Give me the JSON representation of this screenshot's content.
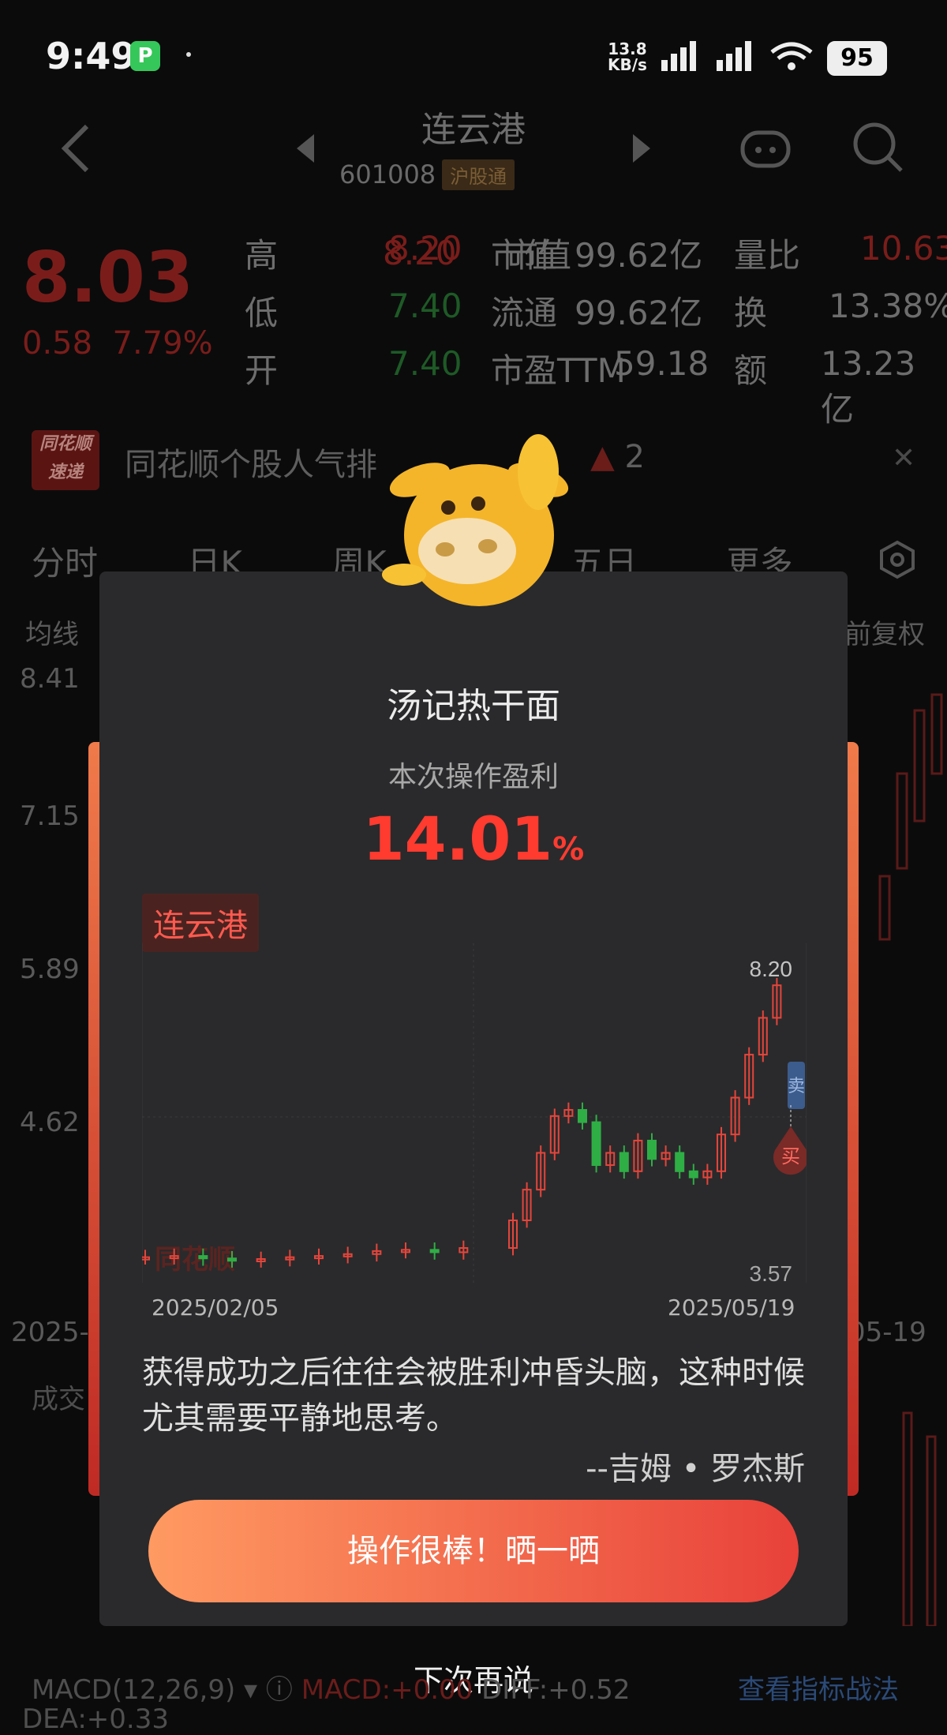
{
  "status_bar": {
    "time": "9:49",
    "app_icon": "P",
    "net_speed_value": "13.8",
    "net_speed_unit": "KB/s",
    "battery": "95"
  },
  "header": {
    "name": "连云港",
    "code": "601008",
    "tag": "沪股通"
  },
  "quote": {
    "price": "8.03",
    "change": "0.58",
    "change_pct": "7.79%",
    "rows": [
      {
        "k1": "高",
        "v1": "8.20",
        "k2": "市值",
        "v2": "99.62亿",
        "k3": "量比",
        "v3": "10.63"
      },
      {
        "k1": "低",
        "v1": "7.40",
        "k2": "流通",
        "v2": "99.62亿",
        "k3": "换",
        "v3": "13.38%"
      },
      {
        "k1": "开",
        "v1": "7.40",
        "k2": "市盈TTM",
        "v2": "59.18",
        "k3": "额",
        "v3": "13.23亿"
      }
    ]
  },
  "banner": {
    "logo_top": "同花顺",
    "logo_bottom": "速递",
    "text": "同花顺个股人气排",
    "rank": "2"
  },
  "tabs": [
    "分时",
    "日K",
    "周K",
    "",
    "五日",
    "更多"
  ],
  "subrow": {
    "left": "均线",
    "right": "前复权"
  },
  "y_axis": [
    "8.41",
    "7.15",
    "5.89",
    "4.62"
  ],
  "bottom_dates": {
    "left": "2025-",
    "right": "05-19"
  },
  "volume_label": "成交",
  "modal": {
    "title": "汤记热干面",
    "subtitle": "本次操作盈利",
    "profit_value": "14.01",
    "profit_unit": "%",
    "stock_tag": "连云港",
    "chart_high": "8.20",
    "chart_low": "3.57",
    "watermark": "同花顺",
    "sell_marker": "卖",
    "buy_marker": "买",
    "date_start": "2025/02/05",
    "date_end": "2025/05/19",
    "quote_text": "获得成功之后往往会被胜利冲昏头脑，这种时候尤其需要平静地思考。",
    "author": "--吉姆 • 罗杰斯",
    "cta": "操作很棒！晒一晒",
    "later": "下次再说"
  },
  "macd": {
    "label": "MACD(12,26,9)",
    "macd_val": "MACD:+0.00",
    "diff": "DIFF:+0.52",
    "dea": "DEA:+0.33",
    "link": "查看指标战法"
  },
  "chart_data": {
    "type": "candlestick",
    "x_start": "2025/02/05",
    "x_end": "2025/05/19",
    "ylim": [
      3.57,
      8.2
    ],
    "close_approx": [
      3.6,
      3.62,
      3.58,
      3.55,
      3.57,
      3.6,
      3.62,
      3.65,
      3.7,
      3.72,
      3.68,
      3.75,
      4.2,
      4.7,
      5.3,
      5.9,
      6.0,
      5.8,
      5.1,
      5.3,
      5.0,
      5.5,
      5.2,
      5.3,
      5.0,
      4.9,
      5.0,
      5.6,
      6.2,
      6.9,
      7.5,
      8.03
    ]
  }
}
